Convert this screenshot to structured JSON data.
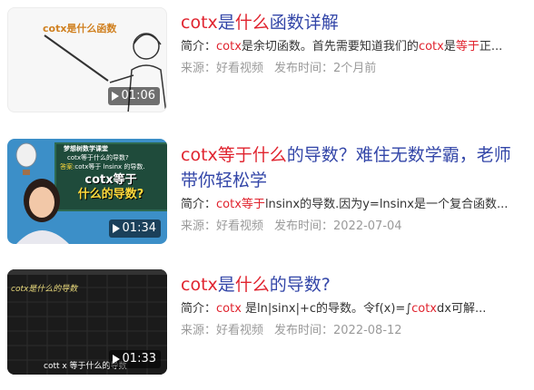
{
  "results": [
    {
      "title_pre": "",
      "title_hl1": "cotx",
      "title_mid1": "是",
      "title_hl2": "什么",
      "title_post": "函数详解",
      "summary_label": "简介：",
      "summary_hl1": "cotx",
      "summary_text1": "是余切函数。首先需要知道我们的",
      "summary_hl2": "cotx",
      "summary_text2": "是",
      "summary_hl3": "等于",
      "summary_text3": "正...",
      "thumb_caption": "cotx是什么函数",
      "duration": "01:06",
      "source": "来源：好看视频",
      "time": "发布时间：2个月前"
    },
    {
      "title_hl1": "cotx",
      "title_mid1": "等于",
      "title_hl2": "什么",
      "title_post": "的导数？难住无数学霸，老师带你轻松学",
      "summary_label": "简介：",
      "summary_hl1": "cotx",
      "summary_text1": "",
      "summary_hl2": "等于",
      "summary_text2": "lnsinx的导数.因为y=lnsinx是一个复合函数...",
      "thumb_header": "梦想树数学课堂",
      "thumb_q": "cotx等于什么的导数?",
      "thumb_a_label": "答案:",
      "thumb_a_text": "cotx等于 lnsinx 的导数.",
      "thumb_big1": "cotx等于",
      "thumb_big2": "什么的导数?",
      "duration": "01:34",
      "source": "来源：好看视频",
      "time": "发布时间：2022-07-04"
    },
    {
      "title_hl1": "cotx",
      "title_mid1": "是",
      "title_hl2": "什么",
      "title_post": "的导数?",
      "summary_label": "简介：",
      "summary_hl1": "cotx",
      "summary_text1": " 是ln|sinx|+c的导数。令f(x)=∫",
      "summary_hl2": "cotx",
      "summary_text2": "dx可解...",
      "thumb_board": "cotx是什么的导数",
      "thumb_caption": "cott x 等于什么的导数",
      "duration": "01:33",
      "source": "来源：好看视频",
      "time": "发布时间：2022-08-12"
    }
  ]
}
